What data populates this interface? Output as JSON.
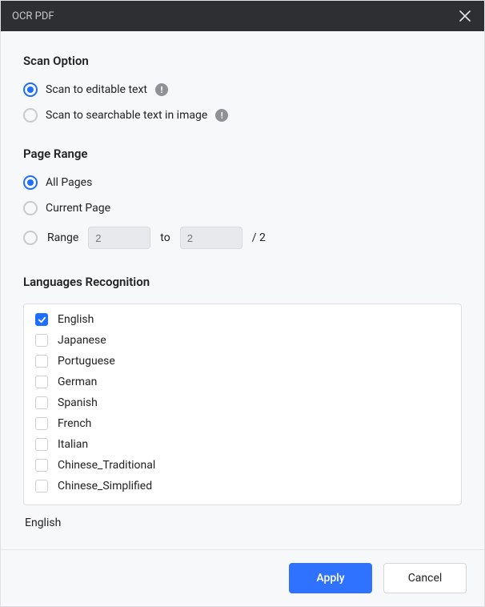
{
  "title": "OCR PDF",
  "sections": {
    "scan_option": {
      "title": "Scan Option",
      "editable": "Scan to editable text",
      "searchable": "Scan to searchable text in image"
    },
    "page_range": {
      "title": "Page Range",
      "all": "All Pages",
      "current": "Current Page",
      "range": "Range",
      "to": "to",
      "from_placeholder": "2",
      "to_placeholder": "2",
      "total": "/ 2"
    },
    "languages": {
      "title": "Languages Recognition",
      "items": [
        {
          "label": "English",
          "checked": true
        },
        {
          "label": "Japanese",
          "checked": false
        },
        {
          "label": "Portuguese",
          "checked": false
        },
        {
          "label": "German",
          "checked": false
        },
        {
          "label": "Spanish",
          "checked": false
        },
        {
          "label": "French",
          "checked": false
        },
        {
          "label": "Italian",
          "checked": false
        },
        {
          "label": "Chinese_Traditional",
          "checked": false
        },
        {
          "label": "Chinese_Simplified",
          "checked": false
        }
      ],
      "selected_summary": "English"
    }
  },
  "footer": {
    "apply": "Apply",
    "cancel": "Cancel"
  }
}
